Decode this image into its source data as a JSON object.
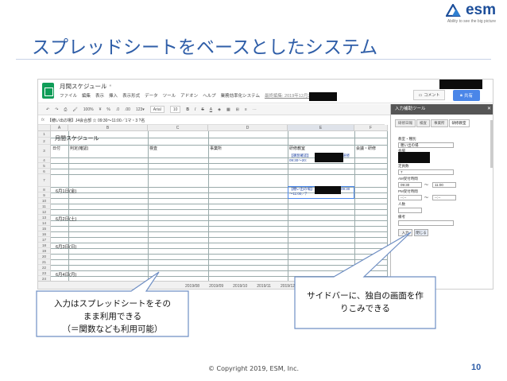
{
  "slide": {
    "title": "スプレッドシートをベースとしたシステム",
    "logo_text": "esm",
    "logo_subtext": "Ability to see the big picture",
    "copyright": "© Copyright 2019, ESM, Inc.",
    "page_number": "10",
    "colors": {
      "title": "#2f5ea8",
      "rule": "#c8d3e6",
      "callout_border": "#6f8fc4",
      "accent": "#4a86e8"
    }
  },
  "sheet": {
    "doc_title": "月間スケジュール",
    "menu": [
      "ファイル",
      "編集",
      "表示",
      "挿入",
      "表示形式",
      "データ",
      "ツール",
      "アドオン",
      "ヘルプ",
      "業務効率化システム",
      "最終編集: 2019年12月24日"
    ],
    "comment_label": "コメント",
    "share_label": "共有",
    "toolbar": [
      "100%",
      "¥",
      "%",
      ".0",
      ".00",
      "123▾",
      "Arial",
      "10",
      "B",
      "I",
      "S",
      "A"
    ],
    "formula_ref": "E7",
    "formula_text": "【穂い出の場】J4会合部 ☆ 09:30～11:00／1マ・3 ?名",
    "columns": [
      "",
      "A",
      "B",
      "C",
      "D",
      "E",
      "F"
    ],
    "rows": [
      "1",
      "2",
      "3",
      "4",
      "5",
      "6",
      "7",
      "8",
      "9",
      "10",
      "11",
      "12",
      "13",
      "14",
      "15",
      "16",
      "17",
      "18",
      "19",
      "20",
      "21",
      "22",
      "23",
      "24",
      "25"
    ],
    "sheet_title": "月間スケジュール",
    "headers": [
      "日付",
      "判定(確認)",
      "検査",
      "事業所",
      "研修教室",
      "会議・研修"
    ],
    "dates": [
      "6月1日(金)",
      "6月2日(土)",
      "6月3日(日)",
      "6月4日(月)"
    ],
    "entries": [
      {
        "line1": "【講習確認】",
        "line2": "09:30～20:",
        "line3": "研修"
      },
      {
        "line1": "【穂い出の場】",
        "line2": "～11:00／ｱ",
        "line3": "09:30"
      }
    ],
    "sheet_tabs": [
      "2019/08",
      "2019/09",
      "2019/10",
      "2019/11",
      "2019/12"
    ]
  },
  "sidebar": {
    "title": "入力補助ツール",
    "tabs": [
      "研修日報",
      "検査",
      "事業所",
      "研修教室"
    ],
    "fields": [
      {
        "label": "教室・種別",
        "value": "穂い出の場"
      },
      {
        "label": "会場",
        "value": ""
      },
      {
        "label": "定員数",
        "value": "7"
      },
      {
        "label": "AM受付時間",
        "from": "09:30",
        "to": "11:00"
      },
      {
        "label": "PM受付時間",
        "from": "--:--",
        "to": "--:--"
      },
      {
        "label": "人数",
        "value": ""
      },
      {
        "label": "備考",
        "value": ""
      }
    ],
    "input_button": "入力",
    "close_button": "閉じる"
  },
  "callouts": {
    "left": [
      "入力はスプレッドシートをその",
      "まま利用できる",
      "（＝関数なども利用可能）"
    ],
    "right": [
      "サイドバーに、独自の画面を作",
      "りこみできる"
    ]
  }
}
